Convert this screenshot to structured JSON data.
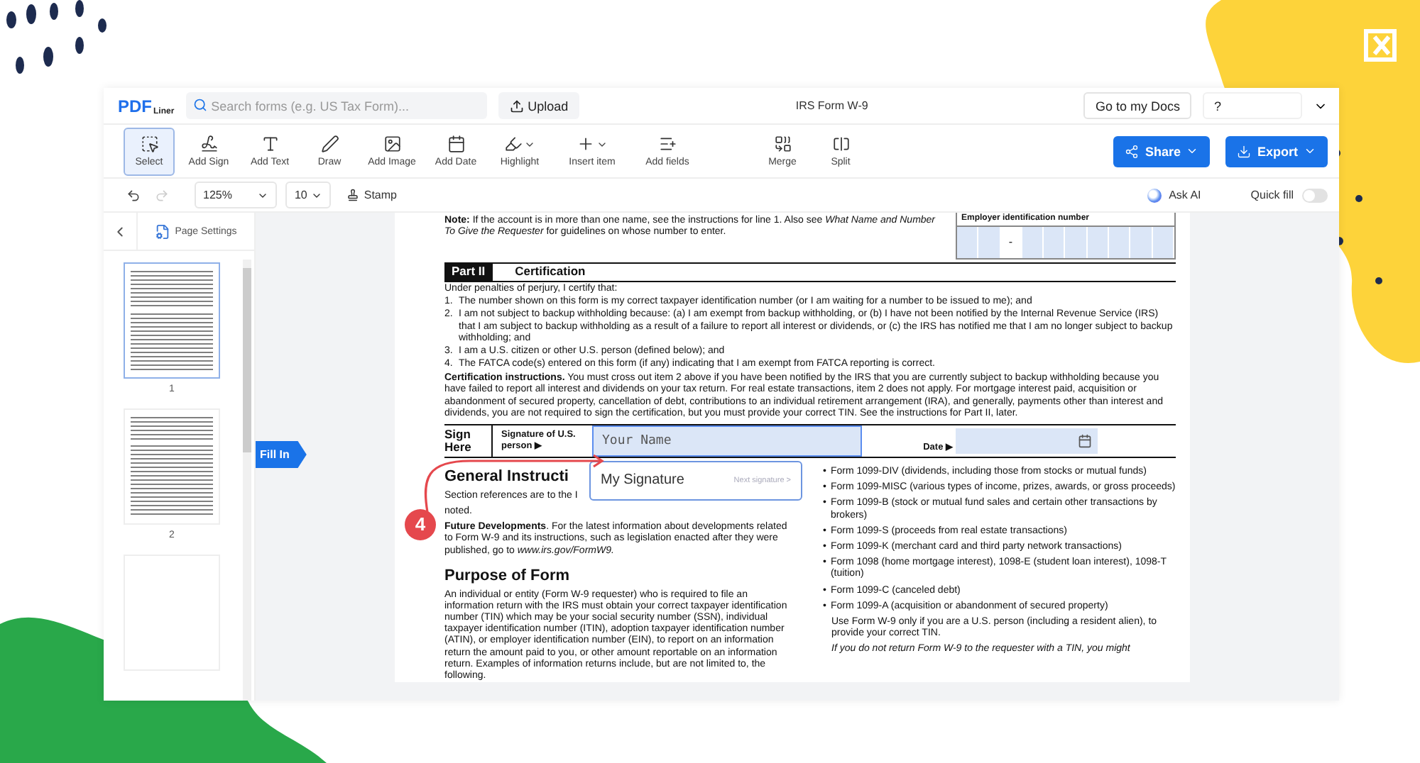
{
  "header": {
    "logo_main": "PDF",
    "logo_sub": "Liner",
    "search": {
      "placeholder": "Search forms (e.g. US Tax Form)..."
    },
    "upload": "Upload",
    "doc_title": "IRS Form W-9",
    "docs_link": "Go to my Docs",
    "help": "?"
  },
  "tools": [
    {
      "label": "Select",
      "selected": true,
      "dropdown": false
    },
    {
      "label": "Add Sign",
      "selected": false,
      "dropdown": false
    },
    {
      "label": "Add Text",
      "selected": false,
      "dropdown": false
    },
    {
      "label": "Draw",
      "selected": false,
      "dropdown": false
    },
    {
      "label": "Add Image",
      "selected": false,
      "dropdown": false
    },
    {
      "label": "Add Date",
      "selected": false,
      "dropdown": false
    },
    {
      "label": "Highlight",
      "selected": false,
      "dropdown": true
    },
    {
      "label": "Insert item",
      "selected": false,
      "dropdown": true
    },
    {
      "label": "Add fields",
      "selected": false,
      "dropdown": false
    }
  ],
  "page_tools": [
    {
      "label": "Merge",
      "selected": false,
      "dropdown": false
    },
    {
      "label": "Split",
      "selected": false,
      "dropdown": false
    }
  ],
  "actions": [
    {
      "label": "Share"
    },
    {
      "label": "Export"
    }
  ],
  "subbar": {
    "undo": {
      "disabled": false
    },
    "redo": {
      "disabled": true
    },
    "zoom": "125%",
    "font_size": "10",
    "stamp": "Stamp",
    "ask_ai": "Ask AI",
    "quick_fill": {
      "label": "Quick fill",
      "on": false
    }
  },
  "sidebar": {
    "page_settings": "Page Settings",
    "pages": [
      {
        "number": "1",
        "selected": true,
        "kind": "form"
      },
      {
        "number": "2",
        "selected": false,
        "kind": "text"
      },
      {
        "selected": false,
        "kind": "blank"
      }
    ]
  },
  "fill_in_tag": "Fill In",
  "document": {
    "note": "**Note:** If the account is in more than one name, see the instructions for line 1. Also see *What Name and Number To Give the Requester* for guidelines on whose number to enter.",
    "ein_label": "Employer identification number",
    "ein_dash": "-",
    "part_tag": "Part II",
    "part_title": "Certification",
    "intro": "Under penalties of perjury, I certify that:",
    "items": [
      {
        "number": "1.",
        "text": "The number shown on this form is my correct taxpayer identification number (or I am waiting for a number to be issued to me); and"
      },
      {
        "number": "2.",
        "text": "I am not subject to backup withholding because: (a) I am exempt from backup withholding, or (b) I have not been notified by the Internal Revenue Service (IRS) that I am subject to backup withholding as a result of a failure to report all interest or dividends, or (c) the IRS has notified me that I am no longer subject to backup withholding; and"
      },
      {
        "number": "3.",
        "text": "I am a U.S. citizen or other U.S. person (defined below); and"
      },
      {
        "number": "4.",
        "text": "The FATCA code(s) entered on this form (if any) indicating that I am exempt from FATCA reporting is correct."
      }
    ],
    "cert_instructions": "**Certification instructions.** You must cross out item 2 above if you have been notified by the IRS that you are currently subject to backup withholding because you have failed to report all interest and dividends on your tax return. For real estate transactions, item 2 does not apply. For mortgage interest paid, acquisition or abandonment of secured property, cancellation of debt, contributions to an individual retirement arrangement (IRA), and generally, payments other than interest and dividends, you are not required to sign the certification, but you must provide your correct TIN. See the instructions for Part II, later.",
    "sign": {
      "label_top": "Sign",
      "label_bottom": "Here",
      "signature_label": "Signature of U.S. person ▶",
      "signature_placeholder": "Your Name",
      "date_label": "Date ▶"
    },
    "left_column": [
      {
        "kind": "heading",
        "text": "General Instructi"
      },
      {
        "kind": "paragraph",
        "text": "Section references are to the I"
      },
      {
        "kind": "paragraph",
        "text": "noted."
      },
      {
        "kind": "paragraph",
        "text": "**Future Developments**. For the latest information about developments related to Form W-9 and its instructions, such as legislation enacted after they were published, go to *www.irs.gov/FormW9.*"
      },
      {
        "kind": "heading",
        "text": "Purpose of Form"
      },
      {
        "kind": "paragraph",
        "text": "An individual or entity (Form W-9 requester) who is required to file an information return with the IRS must obtain your correct taxpayer identification number (TIN) which may be your social security number (SSN), individual taxpayer identification number (ITIN), adoption taxpayer identification number (ATIN), or employer identification number (EIN), to report on an information return the amount paid to you, or other amount reportable on an information return. Examples of information returns include, but are not limited to, the following."
      }
    ],
    "right_column": [
      {
        "kind": "bullet",
        "mark": "•",
        "text": "Form 1099-DIV (dividends, including those from stocks or mutual funds)"
      },
      {
        "kind": "bullet",
        "mark": "•",
        "text": "Form 1099-MISC (various types of income, prizes, awards, or gross proceeds)"
      },
      {
        "kind": "bullet",
        "mark": "•",
        "text": "Form 1099-B (stock or mutual fund sales and certain other transactions by brokers)"
      },
      {
        "kind": "bullet",
        "mark": "•",
        "text": "Form 1099-S (proceeds from real estate transactions)"
      },
      {
        "kind": "bullet",
        "mark": "•",
        "text": "Form 1099-K (merchant card and third party network transactions)"
      },
      {
        "kind": "bullet",
        "mark": "•",
        "text": "Form 1098 (home mortgage interest), 1098-E (student loan interest), 1098-T (tuition)"
      },
      {
        "kind": "bullet",
        "mark": "•",
        "text": "Form 1099-C (canceled debt)"
      },
      {
        "kind": "bullet",
        "mark": "•",
        "text": "Form 1099-A (acquisition or abandonment of secured property)"
      },
      {
        "kind": "indent",
        "text": "Use Form W-9 only if you are a U.S. person (including a resident alien), to provide your correct TIN."
      },
      {
        "kind": "italic",
        "text": "If you do not return Form W-9 to the requester with a TIN, you might"
      }
    ]
  },
  "signature_popup": {
    "title": "My Signature",
    "next": "Next signature >"
  },
  "step_badge": "4"
}
